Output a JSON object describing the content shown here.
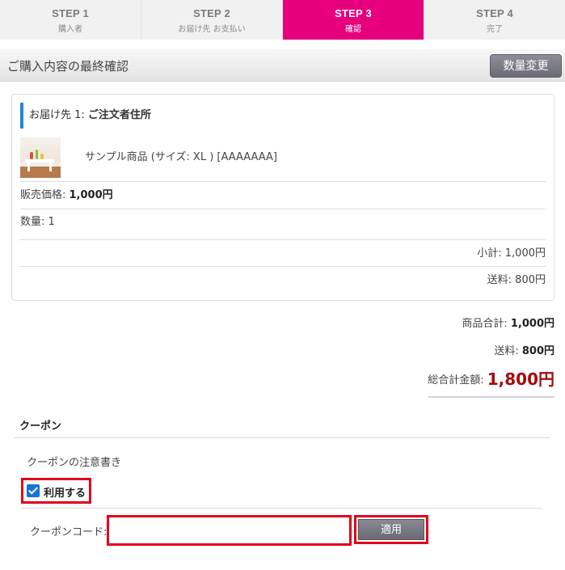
{
  "steps": [
    {
      "num": "STEP 1",
      "label": "購入者"
    },
    {
      "num": "STEP 2",
      "label": "お届け先 お支払い"
    },
    {
      "num": "STEP 3",
      "label": "確認"
    },
    {
      "num": "STEP 4",
      "label": "完了"
    }
  ],
  "active_step": 3,
  "header": {
    "title": "ご購入内容の最終確認",
    "qty_change_label": "数量変更"
  },
  "shipment": {
    "dest_prefix": "お届け先 1: ",
    "dest_name": "ご注文者住所",
    "product_name": "サンプル商品 (サイズ: XL ) [AAAAAAA]",
    "price_label": "販売価格: ",
    "price_value": "1,000円",
    "quantity_text": "数量: 1",
    "subtotal_text": "小計: 1,000円",
    "shipping_text": "送料: 800円"
  },
  "totals": {
    "product_total_label": "商品合計: ",
    "product_total_value": "1,000円",
    "shipping_label": "送料: ",
    "shipping_value": "800円",
    "grand_total_label": "総合計金額: ",
    "grand_total_value": "1,800円"
  },
  "coupon": {
    "title": "クーポン",
    "note": "クーポンの注意書き",
    "use_label": "利用する",
    "use_checked": true,
    "code_label": "クーポンコード:",
    "code_value": "",
    "apply_label": "適用"
  },
  "colors": {
    "active_step": "#e6007e",
    "grand_total": "#a40c0c",
    "highlight_box": "#e2001a",
    "dest_accent": "#1e88d2"
  }
}
